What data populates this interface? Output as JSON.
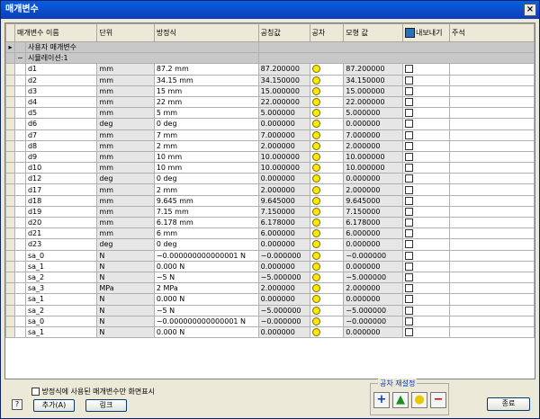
{
  "title": "매개변수",
  "close_glyph": "×",
  "header": {
    "name": "매개변수 이름",
    "unit": "단위",
    "equation": "방정식",
    "nominal": "공칭값",
    "tol": "공차",
    "model": "모형 값",
    "export": "내보내기",
    "comment": "주석"
  },
  "groups": {
    "user": "사용자 매개변수",
    "sim": "시뮬레이션:1",
    "collapse_glyph": "−",
    "row_pointer": "▸"
  },
  "rows": [
    {
      "name": "d1",
      "unit": "mm",
      "eq": "87.2 mm",
      "nominal": "87.200000",
      "model": "87.200000"
    },
    {
      "name": "d2",
      "unit": "mm",
      "eq": "34.15 mm",
      "nominal": "34.150000",
      "model": "34.150000"
    },
    {
      "name": "d3",
      "unit": "mm",
      "eq": "15 mm",
      "nominal": "15.000000",
      "model": "15.000000"
    },
    {
      "name": "d4",
      "unit": "mm",
      "eq": "22 mm",
      "nominal": "22.000000",
      "model": "22.000000"
    },
    {
      "name": "d5",
      "unit": "mm",
      "eq": "5 mm",
      "nominal": "5.000000",
      "model": "5.000000"
    },
    {
      "name": "d6",
      "unit": "deg",
      "eq": "0 deg",
      "nominal": "0.000000",
      "model": "0.000000"
    },
    {
      "name": "d7",
      "unit": "mm",
      "eq": "7 mm",
      "nominal": "7.000000",
      "model": "7.000000"
    },
    {
      "name": "d8",
      "unit": "mm",
      "eq": "2 mm",
      "nominal": "2.000000",
      "model": "2.000000"
    },
    {
      "name": "d9",
      "unit": "mm",
      "eq": "10 mm",
      "nominal": "10.000000",
      "model": "10.000000"
    },
    {
      "name": "d10",
      "unit": "mm",
      "eq": "10 mm",
      "nominal": "10.000000",
      "model": "10.000000"
    },
    {
      "name": "d12",
      "unit": "deg",
      "eq": "0 deg",
      "nominal": "0.000000",
      "model": "0.000000"
    },
    {
      "name": "d17",
      "unit": "mm",
      "eq": "2 mm",
      "nominal": "2.000000",
      "model": "2.000000"
    },
    {
      "name": "d18",
      "unit": "mm",
      "eq": "9.645 mm",
      "nominal": "9.645000",
      "model": "9.645000"
    },
    {
      "name": "d19",
      "unit": "mm",
      "eq": "7.15 mm",
      "nominal": "7.150000",
      "model": "7.150000"
    },
    {
      "name": "d20",
      "unit": "mm",
      "eq": "6.178 mm",
      "nominal": "6.178000",
      "model": "6.178000"
    },
    {
      "name": "d21",
      "unit": "mm",
      "eq": "6 mm",
      "nominal": "6.000000",
      "model": "6.000000"
    },
    {
      "name": "d23",
      "unit": "deg",
      "eq": "0 deg",
      "nominal": "0.000000",
      "model": "0.000000"
    },
    {
      "name": "sa_0",
      "unit": "N",
      "eq": "−0.000000000000001 N",
      "nominal": "−0.000000",
      "model": "−0.000000"
    },
    {
      "name": "sa_1",
      "unit": "N",
      "eq": "0.000 N",
      "nominal": "0.000000",
      "model": "0.000000"
    },
    {
      "name": "sa_2",
      "unit": "N",
      "eq": "−5 N",
      "nominal": "−5.000000",
      "model": "−5.000000"
    },
    {
      "name": "sa_3",
      "unit": "MPa",
      "eq": "2 MPa",
      "nominal": "2.000000",
      "model": "2.000000"
    },
    {
      "name": "sa_1",
      "unit": "N",
      "eq": "0.000 N",
      "nominal": "0.000000",
      "model": "0.000000"
    },
    {
      "name": "sa_2",
      "unit": "N",
      "eq": "−5 N",
      "nominal": "−5.000000",
      "model": "−5.000000"
    },
    {
      "name": "sa_0",
      "unit": "N",
      "eq": "−0.000000000000001 N",
      "nominal": "−0.000000",
      "model": "−0.000000"
    },
    {
      "name": "sa_1",
      "unit": "N",
      "eq": "0.000 N",
      "nominal": "0.000000",
      "model": "0.000000"
    }
  ],
  "footer": {
    "only_used": "방정식에 사용된 매개변수만 화면표시",
    "help": "?",
    "add": "추가(A)",
    "link": "링크",
    "tol_reset": "공차 재설정",
    "tol_upper": "+",
    "tol_median": "▲",
    "tol_nominal": "●",
    "tol_lower": "−",
    "close": "종료"
  },
  "colors": {
    "indicator": "#ffea00",
    "titlebar": "#0a4fd0"
  }
}
